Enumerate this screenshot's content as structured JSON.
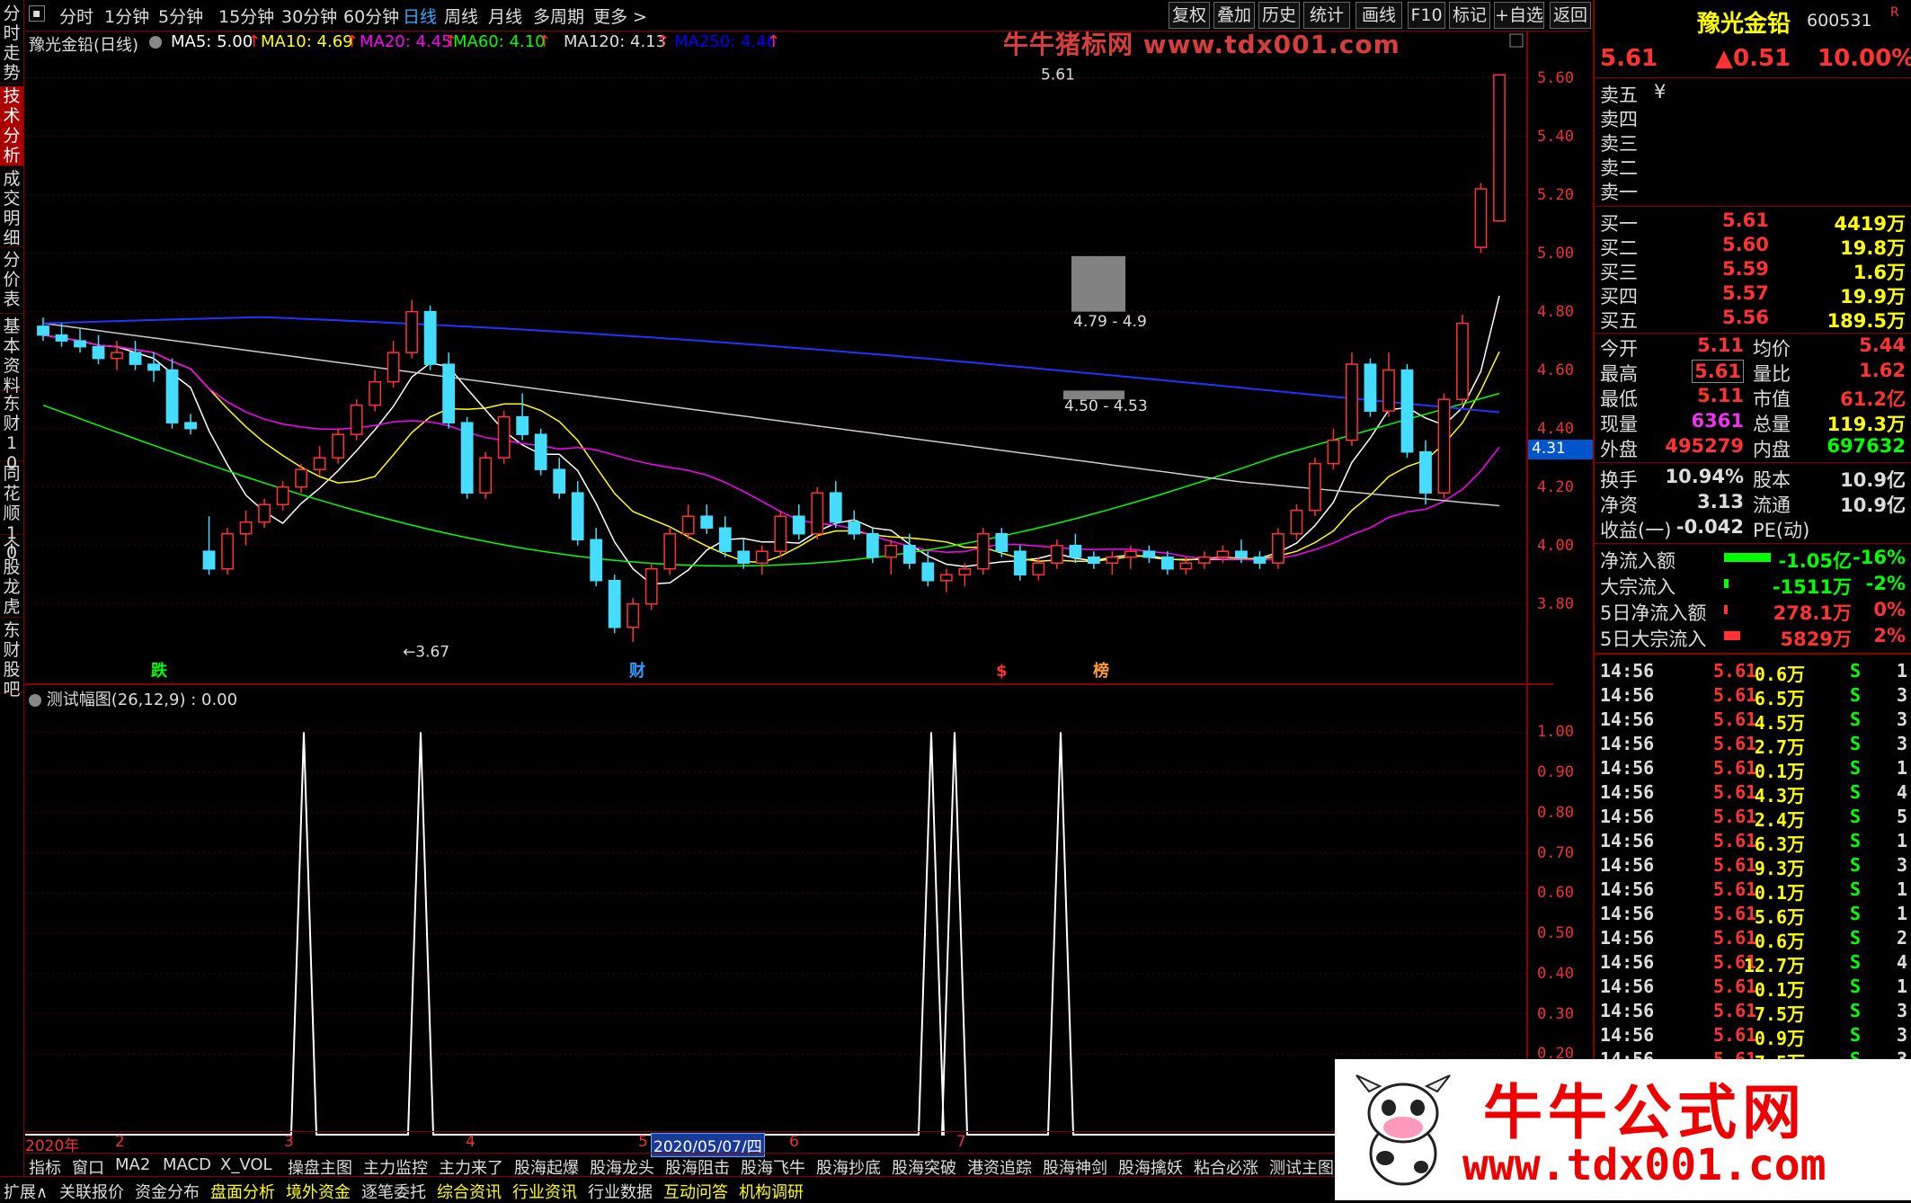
{
  "topbar": {
    "periods": [
      "分时",
      "1分钟",
      "5分钟",
      "15分钟",
      "30分钟",
      "60分钟",
      "日线",
      "周线",
      "月线",
      "多周期",
      "更多 >"
    ],
    "active": "日线",
    "tools": [
      "复权",
      "叠加",
      "历史",
      "统计",
      "画线",
      "F10",
      "标记",
      "+自选",
      "返回"
    ]
  },
  "left_tabs": [
    "分时走势",
    "技术分析",
    "成交明细",
    "分价表",
    "基本资料",
    "东财10",
    "同花顺10",
    "个股龙虎",
    "东财股吧"
  ],
  "left_active": "技术分析",
  "main_chart": {
    "stock_name": "豫光金铅(日线)",
    "ma": [
      {
        "label": "MA5: 5.00",
        "color": "#ffffff"
      },
      {
        "label": "MA10: 4.69",
        "color": "#ffff00"
      },
      {
        "label": "MA20: 4.45",
        "color": "#ff00ff"
      },
      {
        "label": "MA60: 4.10",
        "color": "#00ff00"
      },
      {
        "label": "MA120: 4.13",
        "color": "#dddddd"
      },
      {
        "label": "MA250: 4.46",
        "color": "#0000ff"
      }
    ],
    "price_axis": [
      "5.60",
      "5.40",
      "5.20",
      "5.00",
      "4.80",
      "4.60",
      "4.40",
      "4.20",
      "4.00",
      "3.80"
    ],
    "current_tag": "4.31",
    "annotations": {
      "high": "5.61",
      "low": "3.67",
      "gap1": "4.79 - 4.9",
      "gap2": "4.50 - 4.53"
    },
    "markers": [
      {
        "text": "跌",
        "color": "#00ff00"
      },
      {
        "text": "财",
        "color": "#3399ff"
      },
      {
        "text": "$",
        "color": "#ff3333"
      },
      {
        "text": "榜",
        "color": "#ff9933"
      }
    ],
    "watermark_text": "牛牛猪标网 www.tdx001.com"
  },
  "sub_chart": {
    "title": "测试幅图(26,12,9) : 0.00",
    "axis": [
      "1.00",
      "0.90",
      "0.80",
      "0.70",
      "0.60",
      "0.50",
      "0.40",
      "0.30",
      "0.20"
    ]
  },
  "date_axis": [
    "2020年",
    "2",
    "3",
    "4",
    "5",
    "2020/05/07/四",
    "6",
    "7"
  ],
  "bottom_tabs": [
    "指标",
    "窗口",
    "MA2",
    "MACD",
    "X_VOL",
    "操盘主图",
    "主力监控",
    "主力来了",
    "股海起爆",
    "股海龙头",
    "股海阻击",
    "股海飞牛",
    "股海抄底",
    "股海突破",
    "港资追踪",
    "股海神剑",
    "股海擒妖",
    "粘合必涨",
    "测试主图"
  ],
  "bottom2": [
    "扩展∧",
    "关联报价",
    "资金分布",
    "盘面分析",
    "境外资金",
    "逐笔委托",
    "综合资讯",
    "行业资讯",
    "行业数据",
    "互动问答",
    "机构调研"
  ],
  "quote": {
    "name": "豫光金铅",
    "code": "600531",
    "flag": "R",
    "price": "5.61",
    "change": "▲0.51",
    "pct": "10.00%",
    "asks": [
      {
        "label": "卖五",
        "p": "",
        "v": "¥"
      },
      {
        "label": "卖四",
        "p": "",
        "v": ""
      },
      {
        "label": "卖三",
        "p": "",
        "v": ""
      },
      {
        "label": "卖二",
        "p": "",
        "v": ""
      },
      {
        "label": "卖一",
        "p": "",
        "v": ""
      }
    ],
    "bids": [
      {
        "label": "买一",
        "p": "5.61",
        "v": "4419万"
      },
      {
        "label": "买二",
        "p": "5.60",
        "v": "19.8万"
      },
      {
        "label": "买三",
        "p": "5.59",
        "v": "1.6万"
      },
      {
        "label": "买四",
        "p": "5.57",
        "v": "19.9万"
      },
      {
        "label": "买五",
        "p": "5.56",
        "v": "189.5万"
      }
    ],
    "stats": [
      {
        "l1": "今开",
        "v1": "5.11",
        "l2": "均价",
        "v2": "5.44"
      },
      {
        "l1": "最高",
        "v1": "5.61",
        "l2": "量比",
        "v2": "1.62"
      },
      {
        "l1": "最低",
        "v1": "5.11",
        "l2": "市值",
        "v2": "61.2亿"
      },
      {
        "l1": "现量",
        "v1": "6361",
        "l2": "总量",
        "v2": "119.3万"
      },
      {
        "l1": "外盘",
        "v1": "495279",
        "l2": "内盘",
        "v2": "697632"
      }
    ],
    "stats2": [
      {
        "l1": "换手",
        "v1": "10.94%",
        "l2": "股本",
        "v2": "10.9亿"
      },
      {
        "l1": "净资",
        "v1": "3.13",
        "l2": "流通",
        "v2": "10.9亿"
      },
      {
        "l1": "收益(一)",
        "v1": "-0.042",
        "l2": "PE(动)",
        "v2": ""
      }
    ],
    "flows": [
      {
        "label": "净流入额",
        "v": "-1.05亿",
        "p": "-16%",
        "color": "#00ff00",
        "bar": 1.0
      },
      {
        "label": "大宗流入",
        "v": "-1511万",
        "p": "-2%",
        "color": "#00ff00",
        "bar": 0.1
      },
      {
        "label": "5日净流入额",
        "v": "278.1万",
        "p": "0%",
        "color": "#ff3333",
        "bar": 0.02
      },
      {
        "label": "5日大宗流入",
        "v": "5829万",
        "p": "2%",
        "color": "#ff3333",
        "bar": 0.35
      }
    ]
  },
  "ticks": [
    {
      "t": "14:56",
      "p": "5.61",
      "v": "0.6万",
      "s": "S",
      "n": "1"
    },
    {
      "t": "14:56",
      "p": "5.61",
      "v": "6.5万",
      "s": "S",
      "n": "3"
    },
    {
      "t": "14:56",
      "p": "5.61",
      "v": "4.5万",
      "s": "S",
      "n": "3"
    },
    {
      "t": "14:56",
      "p": "5.61",
      "v": "2.7万",
      "s": "S",
      "n": "3"
    },
    {
      "t": "14:56",
      "p": "5.61",
      "v": "0.1万",
      "s": "S",
      "n": "1"
    },
    {
      "t": "14:56",
      "p": "5.61",
      "v": "4.3万",
      "s": "S",
      "n": "4"
    },
    {
      "t": "14:56",
      "p": "5.61",
      "v": "2.4万",
      "s": "S",
      "n": "5"
    },
    {
      "t": "14:56",
      "p": "5.61",
      "v": "6.3万",
      "s": "S",
      "n": "1"
    },
    {
      "t": "14:56",
      "p": "5.61",
      "v": "9.3万",
      "s": "S",
      "n": "3"
    },
    {
      "t": "14:56",
      "p": "5.61",
      "v": "0.1万",
      "s": "S",
      "n": "1"
    },
    {
      "t": "14:56",
      "p": "5.61",
      "v": "5.6万",
      "s": "S",
      "n": "1"
    },
    {
      "t": "14:56",
      "p": "5.61",
      "v": "0.6万",
      "s": "S",
      "n": "2"
    },
    {
      "t": "14:56",
      "p": "5.61",
      "v": "12.7万",
      "s": "S",
      "n": "4"
    },
    {
      "t": "14:56",
      "p": "5.61",
      "v": "0.1万",
      "s": "S",
      "n": "1"
    },
    {
      "t": "14:56",
      "p": "5.61",
      "v": "7.5万",
      "s": "S",
      "n": "3"
    },
    {
      "t": "14:56",
      "p": "5.61",
      "v": "0.9万",
      "s": "S",
      "n": "3"
    },
    {
      "t": "14:56",
      "p": "5.61",
      "v": "7.5万",
      "s": "S",
      "n": "3"
    }
  ],
  "site_banner": {
    "title": "牛牛公式网",
    "url": "www.tdx001.com"
  },
  "candles": [
    [
      4.75,
      4.78,
      4.7,
      4.72
    ],
    [
      4.72,
      4.76,
      4.68,
      4.7
    ],
    [
      4.7,
      4.74,
      4.66,
      4.68
    ],
    [
      4.68,
      4.72,
      4.62,
      4.64
    ],
    [
      4.64,
      4.7,
      4.6,
      4.66
    ],
    [
      4.66,
      4.7,
      4.6,
      4.62
    ],
    [
      4.62,
      4.66,
      4.56,
      4.6
    ],
    [
      4.6,
      4.64,
      4.4,
      4.42
    ],
    [
      4.42,
      4.45,
      4.38,
      4.4
    ],
    [
      3.98,
      4.1,
      3.9,
      3.92
    ],
    [
      3.92,
      4.06,
      3.9,
      4.04
    ],
    [
      4.04,
      4.12,
      4.0,
      4.08
    ],
    [
      4.08,
      4.16,
      4.06,
      4.14
    ],
    [
      4.14,
      4.22,
      4.12,
      4.2
    ],
    [
      4.2,
      4.28,
      4.18,
      4.26
    ],
    [
      4.26,
      4.34,
      4.24,
      4.3
    ],
    [
      4.3,
      4.4,
      4.28,
      4.38
    ],
    [
      4.38,
      4.5,
      4.36,
      4.48
    ],
    [
      4.48,
      4.6,
      4.46,
      4.56
    ],
    [
      4.56,
      4.7,
      4.54,
      4.66
    ],
    [
      4.66,
      4.84,
      4.64,
      4.8
    ],
    [
      4.8,
      4.82,
      4.6,
      4.62
    ],
    [
      4.62,
      4.66,
      4.4,
      4.42
    ],
    [
      4.42,
      4.44,
      4.16,
      4.18
    ],
    [
      4.18,
      4.32,
      4.16,
      4.3
    ],
    [
      4.3,
      4.46,
      4.28,
      4.44
    ],
    [
      4.44,
      4.52,
      4.36,
      4.38
    ],
    [
      4.38,
      4.4,
      4.24,
      4.26
    ],
    [
      4.26,
      4.3,
      4.16,
      4.18
    ],
    [
      4.18,
      4.22,
      4.0,
      4.02
    ],
    [
      4.02,
      4.06,
      3.86,
      3.88
    ],
    [
      3.88,
      3.9,
      3.7,
      3.72
    ],
    [
      3.72,
      3.82,
      3.67,
      3.8
    ],
    [
      3.8,
      3.94,
      3.78,
      3.92
    ],
    [
      3.92,
      4.06,
      3.9,
      4.04
    ],
    [
      4.04,
      4.14,
      4.02,
      4.1
    ],
    [
      4.1,
      4.14,
      4.04,
      4.06
    ],
    [
      4.06,
      4.1,
      3.96,
      3.98
    ],
    [
      3.98,
      4.02,
      3.92,
      3.94
    ],
    [
      3.94,
      4.0,
      3.9,
      3.98
    ],
    [
      3.98,
      4.12,
      3.96,
      4.1
    ],
    [
      4.1,
      4.14,
      4.02,
      4.04
    ],
    [
      4.04,
      4.2,
      4.02,
      4.18
    ],
    [
      4.18,
      4.22,
      4.06,
      4.08
    ],
    [
      4.08,
      4.12,
      4.02,
      4.04
    ],
    [
      4.04,
      4.06,
      3.94,
      3.96
    ],
    [
      3.96,
      4.02,
      3.9,
      4.0
    ],
    [
      4.0,
      4.04,
      3.92,
      3.94
    ],
    [
      3.94,
      3.98,
      3.86,
      3.88
    ],
    [
      3.88,
      3.92,
      3.84,
      3.9
    ],
    [
      3.9,
      3.94,
      3.86,
      3.92
    ],
    [
      3.92,
      4.06,
      3.9,
      4.04
    ],
    [
      4.04,
      4.06,
      3.96,
      3.98
    ],
    [
      3.98,
      4.0,
      3.88,
      3.9
    ],
    [
      3.9,
      3.96,
      3.88,
      3.94
    ],
    [
      3.94,
      4.02,
      3.92,
      4.0
    ],
    [
      4.0,
      4.04,
      3.94,
      3.96
    ],
    [
      3.96,
      3.98,
      3.92,
      3.94
    ],
    [
      3.94,
      3.98,
      3.9,
      3.96
    ],
    [
      3.96,
      4.0,
      3.92,
      3.98
    ],
    [
      3.98,
      4.0,
      3.94,
      3.96
    ],
    [
      3.96,
      3.98,
      3.9,
      3.92
    ],
    [
      3.92,
      3.96,
      3.9,
      3.94
    ],
    [
      3.94,
      3.98,
      3.92,
      3.96
    ],
    [
      3.96,
      4.0,
      3.94,
      3.98
    ],
    [
      3.98,
      4.02,
      3.94,
      3.96
    ],
    [
      3.96,
      3.98,
      3.92,
      3.94
    ],
    [
      3.94,
      4.06,
      3.92,
      4.04
    ],
    [
      4.04,
      4.14,
      4.02,
      4.12
    ],
    [
      4.12,
      4.3,
      4.1,
      4.28
    ],
    [
      4.28,
      4.4,
      4.26,
      4.36
    ],
    [
      4.36,
      4.66,
      4.34,
      4.62
    ],
    [
      4.62,
      4.64,
      4.44,
      4.46
    ],
    [
      4.46,
      4.66,
      4.44,
      4.6
    ],
    [
      4.6,
      4.62,
      4.3,
      4.32
    ],
    [
      4.32,
      4.36,
      4.14,
      4.18
    ],
    [
      4.18,
      4.52,
      4.16,
      4.5
    ],
    [
      4.5,
      4.79,
      4.48,
      4.76
    ],
    [
      5.02,
      5.24,
      5.0,
      5.22
    ],
    [
      5.11,
      5.61,
      5.11,
      5.61
    ]
  ]
}
